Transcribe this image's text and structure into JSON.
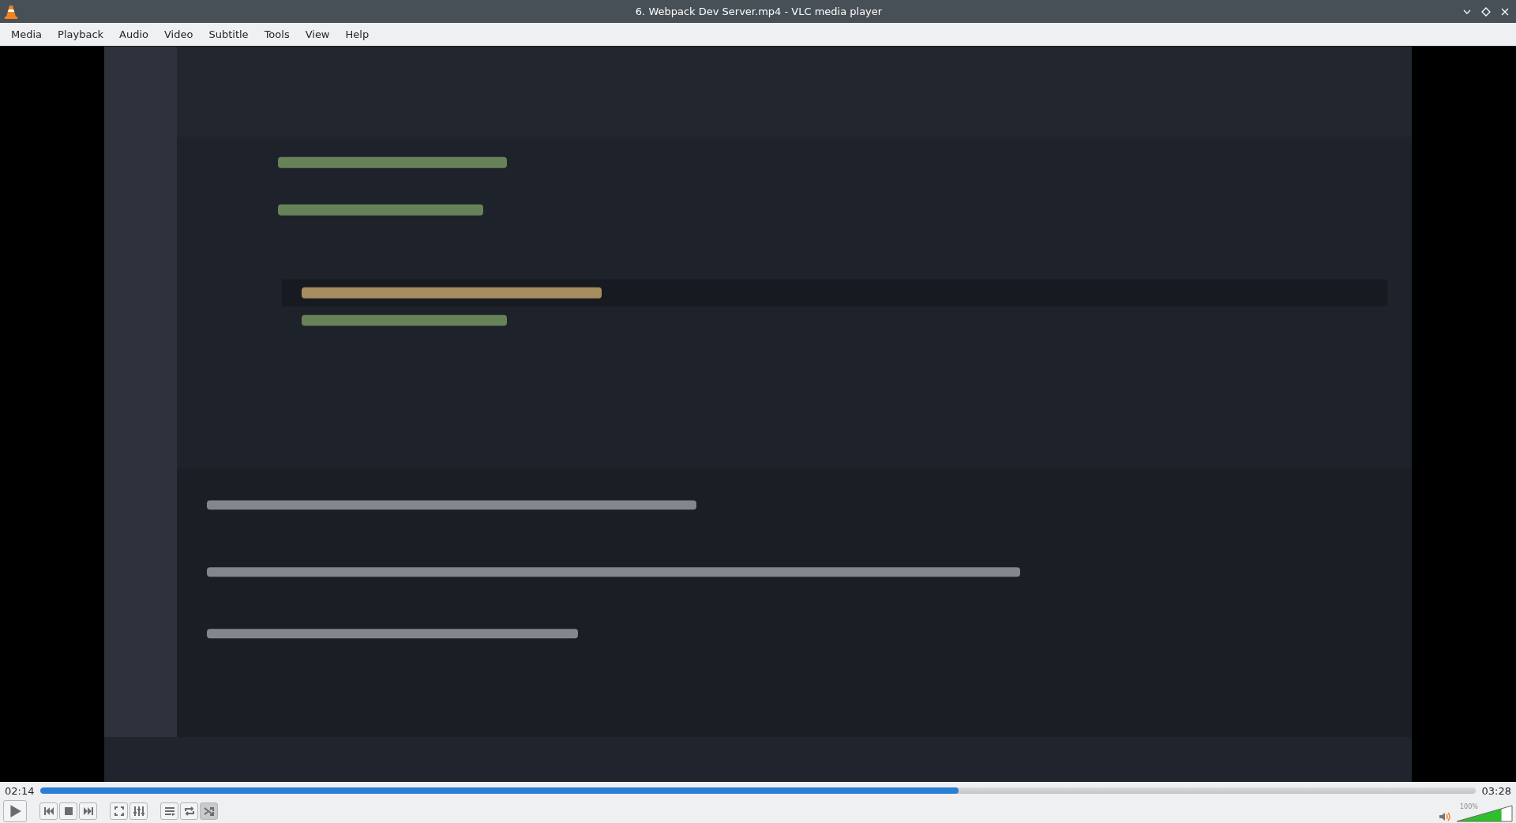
{
  "window": {
    "title": "6. Webpack Dev Server.mp4 - VLC media player"
  },
  "menu": [
    {
      "label": "Media"
    },
    {
      "label": "Playback"
    },
    {
      "label": "Audio"
    },
    {
      "label": "Video"
    },
    {
      "label": "Subtitle"
    },
    {
      "label": "Tools"
    },
    {
      "label": "View"
    },
    {
      "label": "Help"
    }
  ],
  "seek": {
    "elapsed": "02:14",
    "level": 0.64,
    "total": "03:28"
  },
  "controls": [
    {
      "kind": "play"
    },
    {
      "kind": "previous"
    },
    {
      "kind": "stop"
    },
    {
      "kind": "next"
    },
    {
      "kind": "fullscreen"
    },
    {
      "kind": "extended"
    },
    {
      "kind": "playlist"
    },
    {
      "kind": "loop",
      "on": false
    },
    {
      "kind": "random",
      "on": true
    }
  ],
  "volume": {
    "reading": "100%",
    "level": 0.8
  }
}
